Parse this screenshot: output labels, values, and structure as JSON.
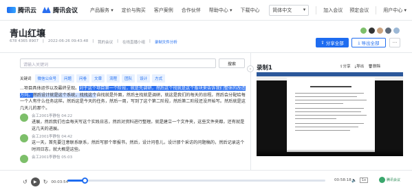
{
  "nav": {
    "logo1": "腾讯云",
    "logo2": "腾讯会议",
    "items": [
      "产品服务 ▾",
      "定价与购买",
      "客户案例",
      "合作伙伴",
      "帮助中心 ▾",
      "下载中心"
    ],
    "language": "简体中文",
    "join": "加入会议",
    "schedule": "预定会议",
    "user_center": "用户中心 ▾"
  },
  "header": {
    "title": "青山红壤",
    "meeting_id": "678 4365 8907",
    "datetime": "2022-06-26 09:43:48",
    "owner": "我的会议",
    "org": "在线直播小组",
    "link": "录制文件分析",
    "share_all": "分享全部",
    "export_all": "导出全部",
    "more": "···"
  },
  "left": {
    "search_placeholder": "请输入关键词",
    "search_button": "搜索",
    "keywords_label": "关键词",
    "keywords": [
      "微信公众号",
      "问题",
      "问卷",
      "文章",
      "流程",
      "团队",
      "设计",
      "方式"
    ],
    "entries": [
      {
        "speaker": "",
        "text_pre": "...项目具体运作以及最终呈现。",
        "text_hl": "对于这个项目第一个阶段，就是先调研，然后这个找就是这个版块来告诉我们整体的改造方向。",
        "text_hl2": "然后设计就是这个系统，找找这个",
        "text_post": "自找就是外面，然后主找就是调研，就这是我们的每天的日程。然后会分配给每一个人有什么任务这样。然后这是今天的任务，然后一周，写到了这个第二阶段，然后第二阶段还没开始写。然后就是这几天儿的那个。"
      },
      {
        "speaker": "会工2001李静怡 04:22",
        "text": "进展，然后我们也会每天写这个实践日志，然后对资料进行整理。就是建立一个文件夹，这些文件夹都，还有就是这几天的进展。"
      },
      {
        "speaker": "会工2001李静怡 04:42",
        "text": "这一天，首先要注意联系联系，然后写那个审报书，然后，设计问卷儿，设计那个采访的问题稿的，然后记录这个时间日志，就大概是这些。"
      },
      {
        "speaker": "会工2001李静怡 05:03",
        "text": ""
      }
    ]
  },
  "right": {
    "title": "录制1",
    "tools": [
      "分享",
      "导出",
      "删除"
    ]
  },
  "player": {
    "current": "00:03:54",
    "total": "00:58:18",
    "progress": 0.067,
    "speed": "1x",
    "brand": "腾讯会议"
  }
}
